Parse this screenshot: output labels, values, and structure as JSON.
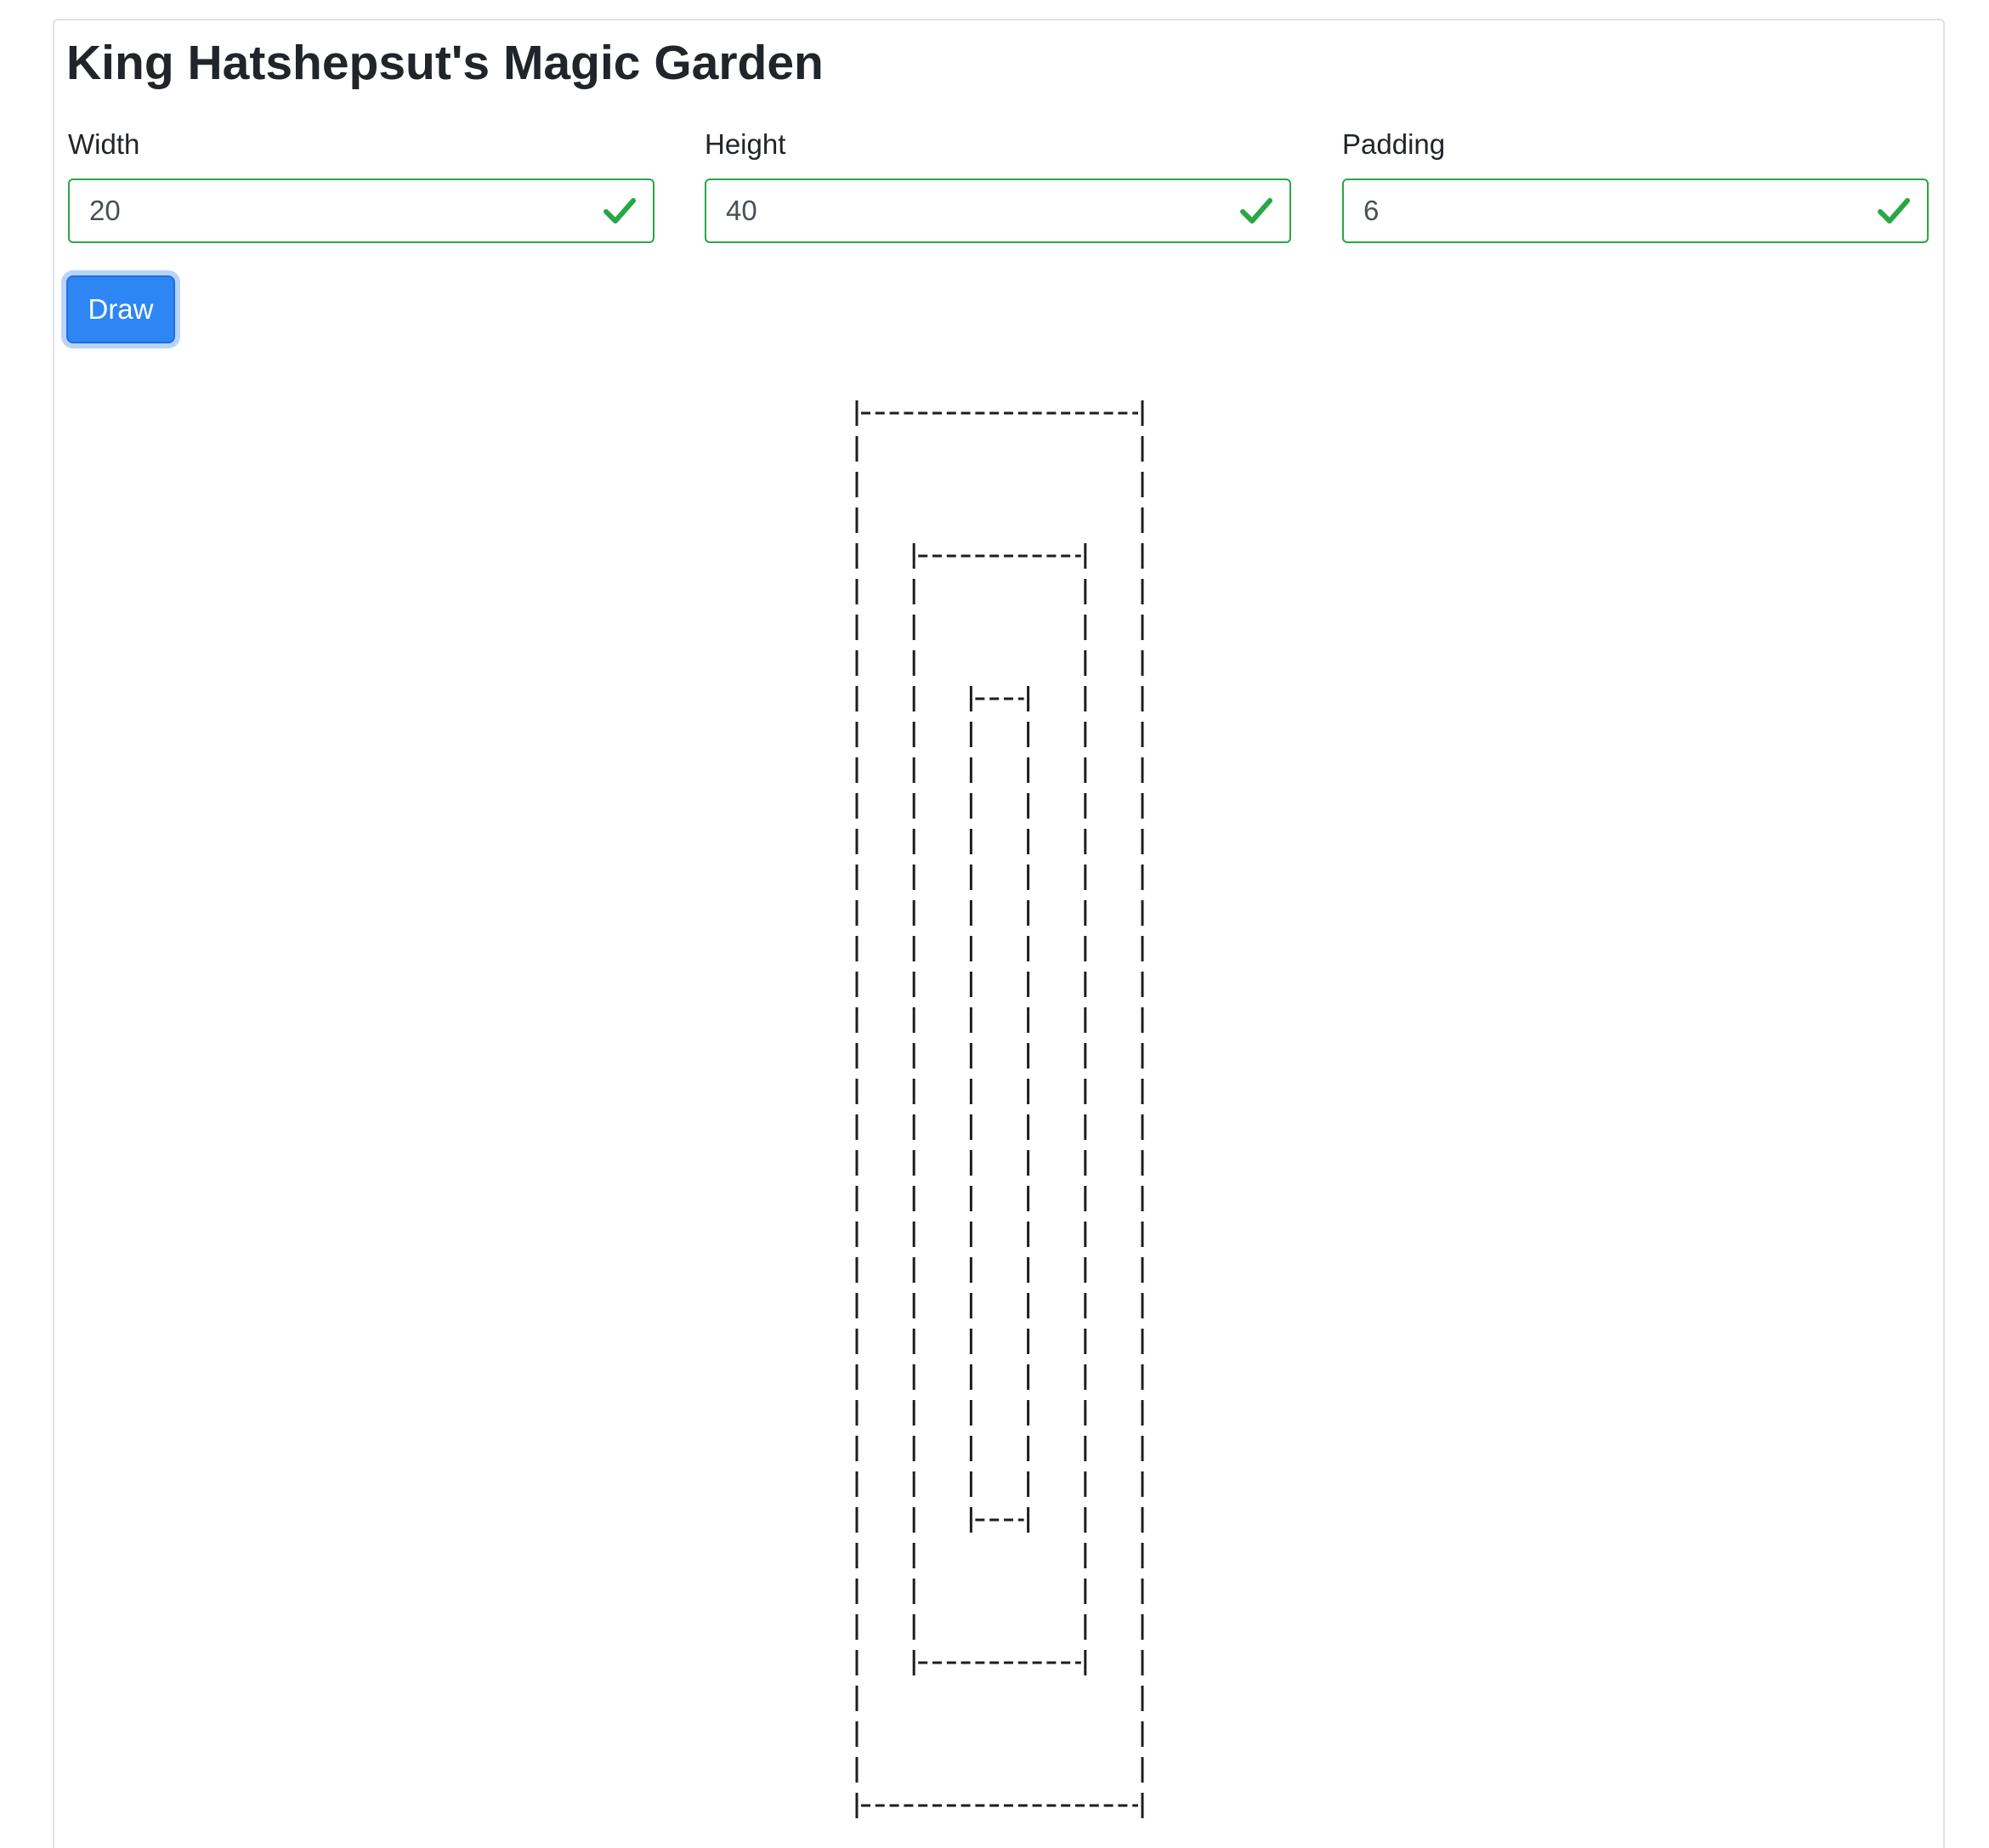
{
  "page": {
    "title": "King Hatshepsut's Magic Garden"
  },
  "form": {
    "width": {
      "label": "Width",
      "value": "20",
      "valid": true
    },
    "height": {
      "label": "Height",
      "value": "40",
      "valid": true
    },
    "padding": {
      "label": "Padding",
      "value": "6",
      "valid": true
    },
    "draw_label": "Draw"
  },
  "garden": {
    "rings": [
      {
        "cols": 20,
        "rows": 40
      },
      {
        "cols": 12,
        "rows": 32
      },
      {
        "cols": 4,
        "rows": 24
      }
    ]
  },
  "colors": {
    "accent": "#2e86f5",
    "valid": "#28a745",
    "text": "#212529",
    "ascii": "#1e1e1e"
  },
  "icons": {
    "valid_indicator": "check-icon"
  }
}
